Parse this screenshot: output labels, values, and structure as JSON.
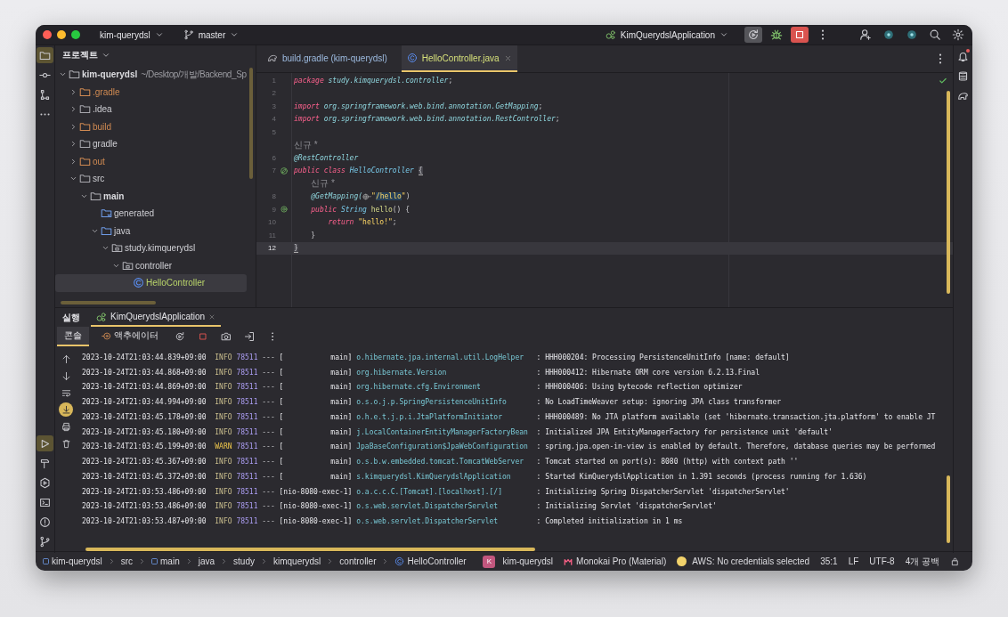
{
  "title_bar": {
    "project": "kim-querydsl",
    "branch": "master",
    "run_config": "KimQuerydslApplication"
  },
  "left_tools_top": [
    {
      "kind": "project",
      "selected": true
    },
    {
      "kind": "commit",
      "selected": false
    },
    {
      "kind": "structure",
      "selected": false
    },
    {
      "kind": "more",
      "selected": false
    }
  ],
  "left_tools_bottom": [
    {
      "kind": "run",
      "selected": true
    },
    {
      "kind": "build",
      "selected": false
    },
    {
      "kind": "services",
      "selected": false
    },
    {
      "kind": "terminal",
      "selected": false
    },
    {
      "kind": "problems",
      "selected": false
    },
    {
      "kind": "git",
      "selected": false
    }
  ],
  "project": {
    "title": "프로젝트",
    "tree": [
      {
        "label": "kim-querydsl",
        "path": "~/Desktop/개발/Backend_Sp",
        "kind": "module",
        "expanded": true,
        "selected": false,
        "children": [
          {
            "label": ".gradle",
            "kind": "excluded",
            "expanded": false,
            "selected": false
          },
          {
            "label": ".idea",
            "kind": "folder",
            "expanded": false,
            "selected": false
          },
          {
            "label": "build",
            "kind": "excluded",
            "expanded": false,
            "selected": false
          },
          {
            "label": "gradle",
            "kind": "folder",
            "expanded": false,
            "selected": false
          },
          {
            "label": "out",
            "kind": "excluded",
            "expanded": false,
            "selected": false
          },
          {
            "label": "src",
            "kind": "folder",
            "expanded": true,
            "selected": false,
            "children": [
              {
                "label": "main",
                "kind": "module",
                "expanded": true,
                "selected": false,
                "children": [
                  {
                    "label": "generated",
                    "kind": "generated",
                    "selected": false
                  },
                  {
                    "label": "java",
                    "kind": "source",
                    "expanded": true,
                    "selected": false,
                    "children": [
                      {
                        "label": "study.kimquerydsl",
                        "kind": "package",
                        "expanded": true,
                        "selected": false,
                        "children": [
                          {
                            "label": "controller",
                            "kind": "package",
                            "expanded": true,
                            "selected": false,
                            "children": [
                              {
                                "label": "HelloController",
                                "kind": "class",
                                "selected": true
                              }
                            ]
                          }
                        ]
                      }
                    ]
                  }
                ]
              }
            ]
          }
        ]
      }
    ]
  },
  "editor": {
    "tabs": [
      {
        "label": "build.gradle (kim-querydsl)",
        "kind": "gradle",
        "selected": false
      },
      {
        "label": "HelloController.java",
        "kind": "class",
        "selected": true
      }
    ],
    "lines": [
      {
        "number": "1",
        "current": false,
        "tokens": [
          {
            "t": "package ",
            "kind": "kw"
          },
          {
            "t": "study.kimquerydsl.controller",
            "kind": "ns"
          },
          {
            "t": ";",
            "kind": "plain"
          }
        ]
      },
      {
        "number": "2",
        "current": false
      },
      {
        "number": "3",
        "current": false,
        "tokens": [
          {
            "t": "import ",
            "kind": "kw"
          },
          {
            "t": "org.springframework.web.bind.annotation.GetMapping",
            "kind": "ns"
          },
          {
            "t": ";",
            "kind": "plain"
          }
        ]
      },
      {
        "number": "4",
        "current": false,
        "tokens": [
          {
            "t": "import ",
            "kind": "kw"
          },
          {
            "t": "org.springframework.web.bind.annotation.RestController",
            "kind": "ns"
          },
          {
            "t": ";",
            "kind": "plain"
          }
        ]
      },
      {
        "number": "5",
        "current": false
      },
      {
        "number": "6",
        "current": false,
        "hint_above": "신규 *",
        "tokens": [
          {
            "t": "@RestController",
            "kind": "ann"
          }
        ]
      },
      {
        "number": "7",
        "current": false,
        "gutter_icon": {
          "kind": "bean"
        },
        "tokens": [
          {
            "t": "public class ",
            "kind": "kw"
          },
          {
            "t": "HelloController ",
            "kind": "type"
          },
          {
            "t": "{",
            "kind": "brace"
          }
        ]
      },
      {
        "number": "8",
        "current": false,
        "hint_above": "신규 *",
        "tokens": [
          {
            "t": "    @GetMapping(",
            "kind": "ann"
          },
          {
            "kind": "globe"
          },
          {
            "t": "\"",
            "kind": "str"
          },
          {
            "t": "/hello",
            "kind": "sel"
          },
          {
            "t": "\"",
            "kind": "str"
          },
          {
            "t": ")",
            "kind": "plain"
          }
        ]
      },
      {
        "number": "9",
        "current": false,
        "gutter_icon": {
          "kind": "endpoint"
        },
        "tokens": [
          {
            "t": "    public ",
            "kind": "kw"
          },
          {
            "t": "String ",
            "kind": "type"
          },
          {
            "t": "hello",
            "kind": "fn"
          },
          {
            "t": "() {",
            "kind": "plain"
          }
        ]
      },
      {
        "number": "10",
        "current": false,
        "tokens": [
          {
            "t": "        return ",
            "kind": "kw"
          },
          {
            "t": "\"hello!\"",
            "kind": "str"
          },
          {
            "t": ";",
            "kind": "plain"
          }
        ]
      },
      {
        "number": "11",
        "current": false,
        "tokens": [
          {
            "t": "    }",
            "kind": "plain"
          }
        ]
      },
      {
        "number": "12",
        "current": true,
        "tokens": [
          {
            "t": "}",
            "kind": "brace"
          }
        ]
      }
    ]
  },
  "right_tools": [
    {
      "kind": "notifications"
    },
    {
      "kind": "database"
    },
    {
      "kind": "gradle"
    }
  ],
  "run": {
    "label": "실행",
    "tabs": [
      {
        "label": "KimQuerydslApplication",
        "selected": true
      }
    ],
    "subtabs": [
      {
        "label": "콘솔",
        "kind": "text",
        "selected": true
      },
      {
        "label": "액추에이터",
        "kind": "actuator",
        "selected": false
      }
    ],
    "console_tools": [
      {
        "kind": "up",
        "on": false
      },
      {
        "kind": "down",
        "on": false
      },
      {
        "kind": "wrap",
        "on": false
      },
      {
        "kind": "scroll-end",
        "on": true
      },
      {
        "kind": "print",
        "on": false
      },
      {
        "kind": "trash",
        "on": false
      }
    ],
    "log": [
      {
        "time": "2023-10-24T21:03:44.839+09:00",
        "severity": "INFO",
        "kind": "info",
        "pid": "78511",
        "sep": "---",
        "thread": "[           main]",
        "logger": "o.hibernate.jpa.internal.util.LogHelper",
        "message": ": HHH000204: Processing PersistenceUnitInfo [name: default]"
      },
      {
        "time": "2023-10-24T21:03:44.868+09:00",
        "severity": "INFO",
        "kind": "info",
        "pid": "78511",
        "sep": "---",
        "thread": "[           main]",
        "logger": "org.hibernate.Version",
        "message": ": HHH000412: Hibernate ORM core version 6.2.13.Final"
      },
      {
        "time": "2023-10-24T21:03:44.869+09:00",
        "severity": "INFO",
        "kind": "info",
        "pid": "78511",
        "sep": "---",
        "thread": "[           main]",
        "logger": "org.hibernate.cfg.Environment",
        "message": ": HHH000406: Using bytecode reflection optimizer"
      },
      {
        "time": "2023-10-24T21:03:44.994+09:00",
        "severity": "INFO",
        "kind": "info",
        "pid": "78511",
        "sep": "---",
        "thread": "[           main]",
        "logger": "o.s.o.j.p.SpringPersistenceUnitInfo",
        "message": ": No LoadTimeWeaver setup: ignoring JPA class transformer"
      },
      {
        "time": "2023-10-24T21:03:45.178+09:00",
        "severity": "INFO",
        "kind": "info",
        "pid": "78511",
        "sep": "---",
        "thread": "[           main]",
        "logger": "o.h.e.t.j.p.i.JtaPlatformInitiator",
        "message": ": HHH000489: No JTA platform available (set 'hibernate.transaction.jta.platform' to enable JT"
      },
      {
        "time": "2023-10-24T21:03:45.180+09:00",
        "severity": "INFO",
        "kind": "info",
        "pid": "78511",
        "sep": "---",
        "thread": "[           main]",
        "logger": "j.LocalContainerEntityManagerFactoryBean",
        "message": ": Initialized JPA EntityManagerFactory for persistence unit 'default'"
      },
      {
        "time": "2023-10-24T21:03:45.199+09:00",
        "severity": "WARN",
        "kind": "warn",
        "pid": "78511",
        "sep": "---",
        "thread": "[           main]",
        "logger": "JpaBaseConfiguration$JpaWebConfiguration",
        "message": ": spring.jpa.open-in-view is enabled by default. Therefore, database queries may be performed"
      },
      {
        "time": "2023-10-24T21:03:45.367+09:00",
        "severity": "INFO",
        "kind": "info",
        "pid": "78511",
        "sep": "---",
        "thread": "[           main]",
        "logger": "o.s.b.w.embedded.tomcat.TomcatWebServer",
        "message": ": Tomcat started on port(s): 8080 (http) with context path ''"
      },
      {
        "time": "2023-10-24T21:03:45.372+09:00",
        "severity": "INFO",
        "kind": "info",
        "pid": "78511",
        "sep": "---",
        "thread": "[           main]",
        "logger": "s.kimquerydsl.KimQuerydslApplication",
        "message": ": Started KimQuerydslApplication in 1.391 seconds (process running for 1.636)"
      },
      {
        "time": "2023-10-24T21:03:53.486+09:00",
        "severity": "INFO",
        "kind": "info",
        "pid": "78511",
        "sep": "---",
        "thread": "[nio-8080-exec-1]",
        "logger": "o.a.c.c.C.[Tomcat].[localhost].[/]",
        "message": ": Initializing Spring DispatcherServlet 'dispatcherServlet'"
      },
      {
        "time": "2023-10-24T21:03:53.486+09:00",
        "severity": "INFO",
        "kind": "info",
        "pid": "78511",
        "sep": "---",
        "thread": "[nio-8080-exec-1]",
        "logger": "o.s.web.servlet.DispatcherServlet",
        "message": ": Initializing Servlet 'dispatcherServlet'"
      },
      {
        "time": "2023-10-24T21:03:53.487+09:00",
        "severity": "INFO",
        "kind": "info",
        "pid": "78511",
        "sep": "---",
        "thread": "[nio-8080-exec-1]",
        "logger": "o.s.web.servlet.DispatcherServlet",
        "message": ": Completed initialization in 1 ms"
      }
    ]
  },
  "status_bar": {
    "breadcrumbs": [
      {
        "label": "kim-querydsl",
        "kind": "module"
      },
      {
        "label": "src",
        "kind": "dir"
      },
      {
        "label": "main",
        "kind": "module"
      },
      {
        "label": "java",
        "kind": "dir"
      },
      {
        "label": "study",
        "kind": "dir"
      },
      {
        "label": "kimquerydsl",
        "kind": "dir"
      },
      {
        "label": "controller",
        "kind": "dir"
      },
      {
        "label": "HelloController",
        "kind": "class"
      }
    ],
    "user_badge": "K",
    "user": "kim-querydsl",
    "theme": "Monokai Pro (Material)",
    "aws": "AWS: No credentials selected",
    "position": "35:1",
    "line_ending": "LF",
    "encoding": "UTF-8",
    "indent": "4개 공백"
  }
}
